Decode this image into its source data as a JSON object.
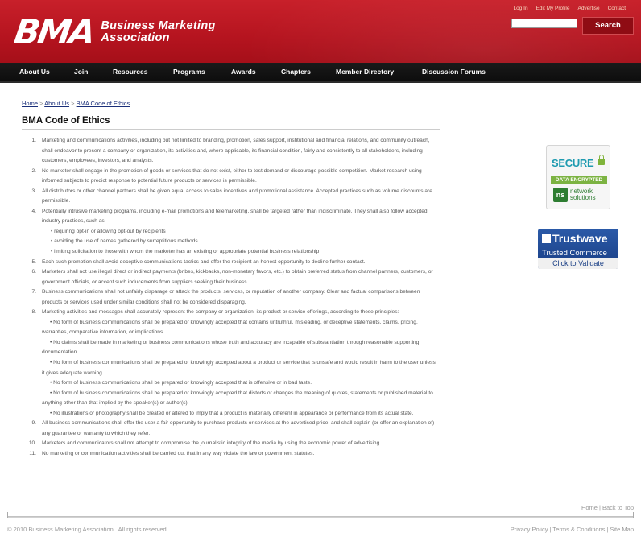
{
  "header": {
    "logo_mark": "BMA",
    "logo_line1": "Business Marketing",
    "logo_line2": "Association",
    "top_links": [
      "Log In",
      "Edit My Profile",
      "Advertise",
      "Contact"
    ],
    "search_placeholder": "",
    "search_button": "Search",
    "colors": {
      "header_red": "#b5141f",
      "nav_black": "#111111"
    }
  },
  "nav": {
    "items": [
      "About Us",
      "Join",
      "Resources",
      "Programs",
      "Awards",
      "Chapters",
      "Member Directory",
      "Discussion Forums"
    ]
  },
  "breadcrumb": {
    "items": [
      "Home",
      "About Us",
      "BMA Code of Ethics"
    ],
    "separator": ">"
  },
  "page": {
    "title": "BMA Code of Ethics"
  },
  "ethics": {
    "items": [
      {
        "num": "1.",
        "text": "Marketing and communications activities, including but not limited to branding, promotion, sales support, institutional and financial relations, and community outreach, shall endeavor to present a company or organization, its activities and, where applicable, its financial condition, fairly and consistently to all stakeholders, including customers, employees, investors, and analysts."
      },
      {
        "num": "2.",
        "text": "No marketer shall engage in the promotion of goods or services that do not exist, either to test demand or discourage possible competition. Market research using informed subjects to predict response to potential future products or services is permissible."
      },
      {
        "num": "3.",
        "text": "All distributors or other channel partners shall be given equal access to sales incentives and promotional assistance. Accepted practices such as volume discounts are permissible."
      },
      {
        "num": "4.",
        "text": "Potentially intrusive marketing programs, including e-mail promotions and telemarketing, shall be targeted rather than indiscriminate. They shall also follow accepted industry practices, such as:"
      },
      {
        "num": "5.",
        "text": "Each such promotion shall avoid deceptive communications tactics and offer the recipient an honest opportunity to decline further contact."
      },
      {
        "num": "6.",
        "text": "Marketers shall not use illegal direct or indirect payments (bribes, kickbacks, non-monetary favors, etc.) to obtain preferred status from channel partners, customers, or government officials, or accept such inducements from suppliers seeking their business."
      },
      {
        "num": "7.",
        "text": "Business communications shall not unfairly disparage or attack the products, services, or reputation of another company. Clear and factual comparisons between products or services used under similar conditions shall not be considered disparaging."
      },
      {
        "num": "8.",
        "text": "Marketing activities and messages shall accurately represent the company or organization, its product or service offerings, according to these principles:"
      },
      {
        "num": "9.",
        "text": "All business communications shall offer the user a fair opportunity to purchase products or services at the advertised price, and shall explain (or offer an explanation of) any guarantee or warranty to which they refer."
      },
      {
        "num": "10.",
        "text": "Marketers and communicators shall not attempt to compromise the journalistic integrity of the media by using the economic power of advertising."
      },
      {
        "num": "11.",
        "text": "No marketing or communication activities shall be carried out that in any way violate the law or government statutes."
      }
    ],
    "item4_bullets": [
      "• requiring opt-in or allowing opt-out by recipients",
      "• avoiding the use of names gathered by surreptitious methods",
      "• limiting solicitation to those with whom the marketer has an existing or appropriate potential business relationship"
    ],
    "item8_subs": [
      "• No form of business communications shall be prepared or knowingly accepted that contains untruthful, misleading, or deceptive statements, claims, pricing, warranties, comparative information, or implications.",
      "• No claims shall be made in marketing or business communications whose truth and accuracy are incapable of substantiation through reasonable supporting documentation.",
      "• No form of business communications shall be prepared or knowingly accepted about a product or service that is unsafe and would result in harm to the user unless it gives adequate warning.",
      "• No form of business communications shall be prepared or knowingly accepted that is offensive or in bad taste.",
      "• No form of business communications shall be prepared or knowingly accepted that distorts or changes the meaning of quotes, statements or published material to anything other than that implied by the speaker(s) or author(s).",
      "• No illustrations or photography shall be created or altered to imply that a product is materially different in appearance or performance from its actual state."
    ]
  },
  "badges": {
    "secure": {
      "word": "SECURE",
      "encrypted": "DATA ENCRYPTED",
      "ns_mark": "ns",
      "ns_line1": "network",
      "ns_line2": "solutions"
    },
    "trustwave": {
      "name": "Trustwave",
      "sub": "Trusted Commerce",
      "cta": "Click to Validate"
    }
  },
  "footer": {
    "home": "Home",
    "back_to_top": "Back to Top",
    "copyright": "© 2010 Business Marketing Association . All rights reserved.",
    "links": [
      "Privacy Policy",
      "Terms & Conditions",
      "Site Map"
    ]
  }
}
